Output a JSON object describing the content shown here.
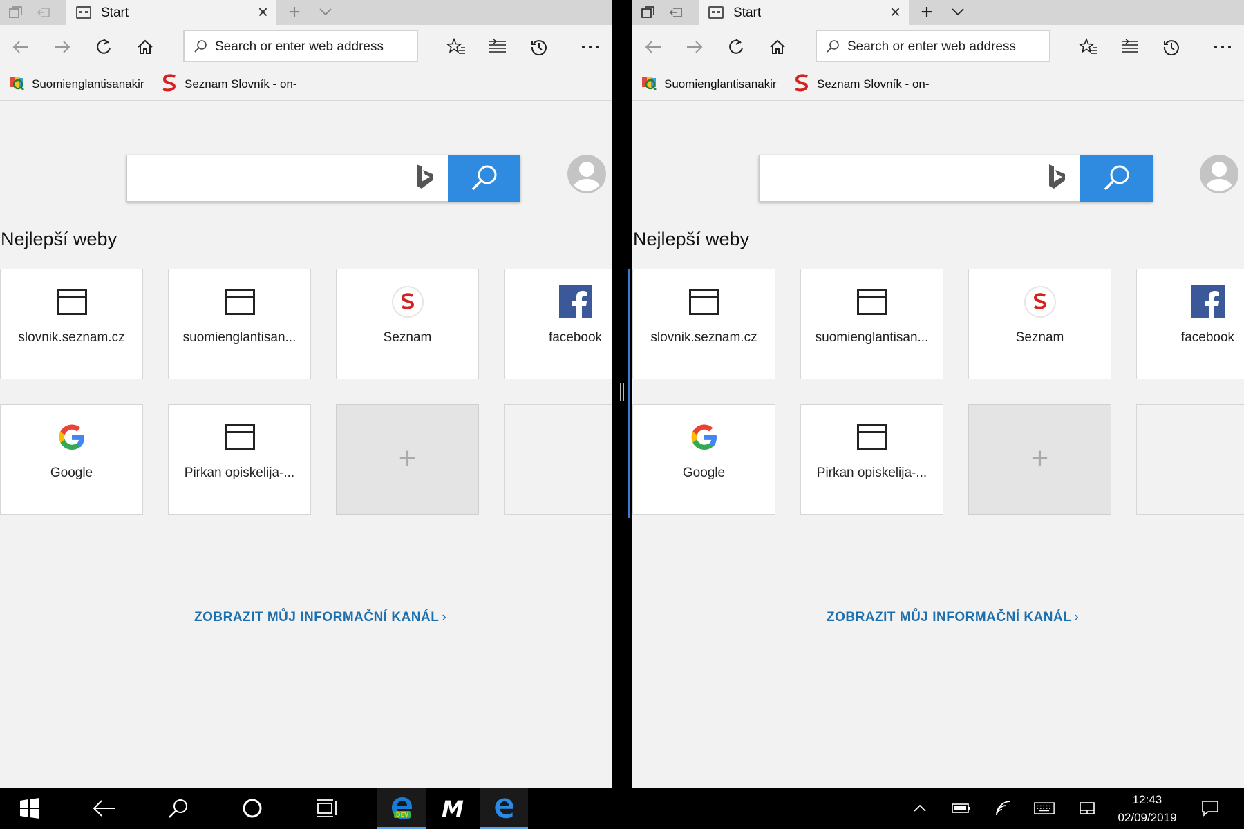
{
  "panes": {
    "left": {
      "tab_title": "Start",
      "address_placeholder": "Search or enter web address",
      "favorites": [
        "Suomienglantisanakir",
        "Seznam Slovník - on-"
      ],
      "section_title": "Nejlepší weby",
      "tiles": [
        "slovnik.seznam.cz",
        "suomienglantisan...",
        "Seznam",
        "facebook",
        "Google",
        "Pirkan opiskelija-..."
      ],
      "add_tile": "+",
      "feed_link": "ZOBRAZIT MŮJ INFORMAČNÍ KANÁL",
      "feed_chevron": "›"
    },
    "right": {
      "tab_title": "Start",
      "address_placeholder": "Search or enter web address",
      "favorites": [
        "Suomienglantisanakir",
        "Seznam Slovník - on-"
      ],
      "section_title": "Nejlepší weby",
      "tiles": [
        "slovnik.seznam.cz",
        "suomienglantisan...",
        "Seznam",
        "facebook",
        "Google",
        "Pirkan opiskelija-..."
      ],
      "add_tile": "+",
      "feed_link": "ZOBRAZIT MŮJ INFORMAČNÍ KANÁL",
      "feed_chevron": "›"
    }
  },
  "taskbar": {
    "time": "12:43",
    "date": "02/09/2019",
    "pinned_apps": [
      "edge-dev-icon",
      "m-app-icon",
      "edge-icon"
    ],
    "edge_dev_badge": "DEV",
    "m_app_letter": "M"
  },
  "colors": {
    "accent": "#2f8bdf",
    "link": "#1e6fae",
    "page_bg": "#f2f2f2",
    "tabstrip_bg": "#d5d5d5",
    "taskbar_bg": "#000000"
  }
}
